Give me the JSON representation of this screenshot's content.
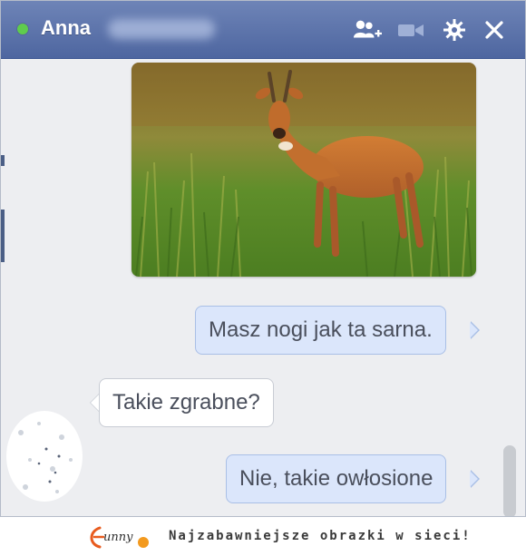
{
  "chat": {
    "contact_name": "Anna",
    "status": "online",
    "colors": {
      "header": "#5a6fa8",
      "online": "#5fcc4d",
      "outgoing_bubble": "#dbe6fb",
      "incoming_bubble": "#ffffff"
    },
    "header_icons": [
      "add-friend-icon",
      "video-call-icon",
      "settings-icon",
      "close-icon"
    ]
  },
  "messages": [
    {
      "direction": "out",
      "type": "image",
      "image": "roe-deer-photo"
    },
    {
      "direction": "out",
      "type": "text",
      "text": "Masz nogi jak ta sarna."
    },
    {
      "direction": "in",
      "type": "text",
      "text": "Takie zgrabne?"
    },
    {
      "direction": "out",
      "type": "text",
      "text": "Nie, takie owłosione"
    }
  ],
  "footer": {
    "logo_text": "funny",
    "tagline": "Najzabawniejsze obrazki w sieci!"
  }
}
